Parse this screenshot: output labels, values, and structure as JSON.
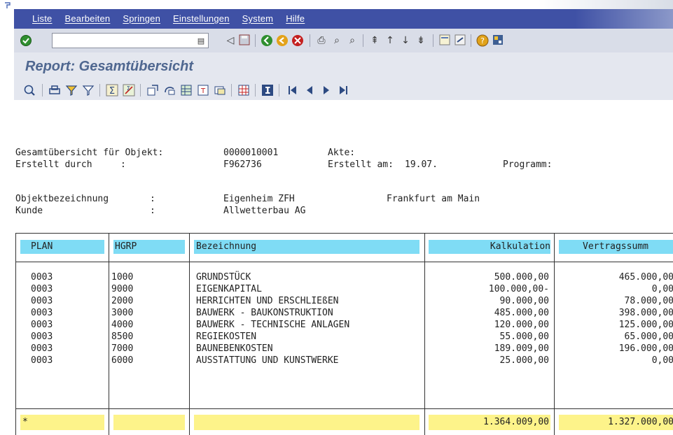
{
  "menu": [
    "Liste",
    "Bearbeiten",
    "Springen",
    "Einstellungen",
    "System",
    "Hilfe"
  ],
  "command_field": {
    "value": ""
  },
  "icons": {
    "system_toolbar": [
      "enter-check-icon",
      "history-icon",
      "back-arrow-icon",
      "save-icon",
      "back-icon",
      "exit-icon",
      "cancel-icon",
      "print-icon",
      "find-icon",
      "find-next-icon",
      "first-page-icon",
      "prev-page-icon",
      "next-page-icon",
      "last-page-icon",
      "new-session-icon",
      "shortcut-icon",
      "help-icon",
      "layout-icon"
    ],
    "app_toolbar": [
      "details-icon",
      "print-icon",
      "filter-icon",
      "delete-filter-icon",
      "sum-icon",
      "subtotal-icon",
      "export-icon",
      "mail-icon",
      "spreadsheet-icon",
      "word-icon",
      "abc-icon",
      "layout-grid-icon",
      "info-icon",
      "first-page-icon",
      "prev-page-icon",
      "next-page-icon",
      "last-page-icon"
    ]
  },
  "title": "Report: Gesamtübersicht",
  "header": {
    "line1_label": "Gesamtübersicht für Objekt:",
    "objekt": "0000010001",
    "akte_label": "Akte:",
    "line2_label": "Erstellt durch",
    "colon": ":",
    "ersteller": "F962736",
    "erstellt_am_label": "Erstellt am:",
    "erstellt_am": "19.07.",
    "programm_label": "Programm:",
    "objektbezeichnung_label": "Objektbezeichnung",
    "objektbezeichnung": "Eigenheim ZFH",
    "ort": "Frankfurt am Main",
    "kunde_label": "Kunde",
    "kunde": "Allwetterbau AG"
  },
  "table": {
    "columns": [
      "PLAN",
      "HGRP",
      "Bezeichnung",
      "Kalkulation",
      "Vertragssumm"
    ],
    "rows": [
      [
        "0003",
        "1000",
        "GRUNDSTÜCK",
        "500.000,00",
        "465.000,00"
      ],
      [
        "0003",
        "9000",
        "EIGENKAPITAL",
        "100.000,00-",
        "0,00"
      ],
      [
        "0003",
        "2000",
        "HERRICHTEN UND ERSCHLIEßEN",
        "90.000,00",
        "78.000,00"
      ],
      [
        "0003",
        "3000",
        "BAUWERK - BAUKONSTRUKTION",
        "485.000,00",
        "398.000,00"
      ],
      [
        "0003",
        "4000",
        "BAUWERK - TECHNISCHE ANLAGEN",
        "120.000,00",
        "125.000,00"
      ],
      [
        "0003",
        "8500",
        "REGIEKOSTEN",
        "55.000,00",
        "65.000,00"
      ],
      [
        "0003",
        "7000",
        "BAUNEBENKOSTEN",
        "189.009,00",
        "196.000,00"
      ],
      [
        "0003",
        "6000",
        "AUSSTATTUNG UND KUNSTWERKE",
        "25.000,00",
        "0,00"
      ]
    ],
    "totals": {
      "marker": "*",
      "kalkulation": "1.364.009,00",
      "vertragssumme": "1.327.000,00"
    }
  },
  "colors": {
    "menubar": "#3f51a5",
    "header_cell": "#7fdcf5",
    "sum_cell": "#fdf38a",
    "title": "#4f6790"
  }
}
